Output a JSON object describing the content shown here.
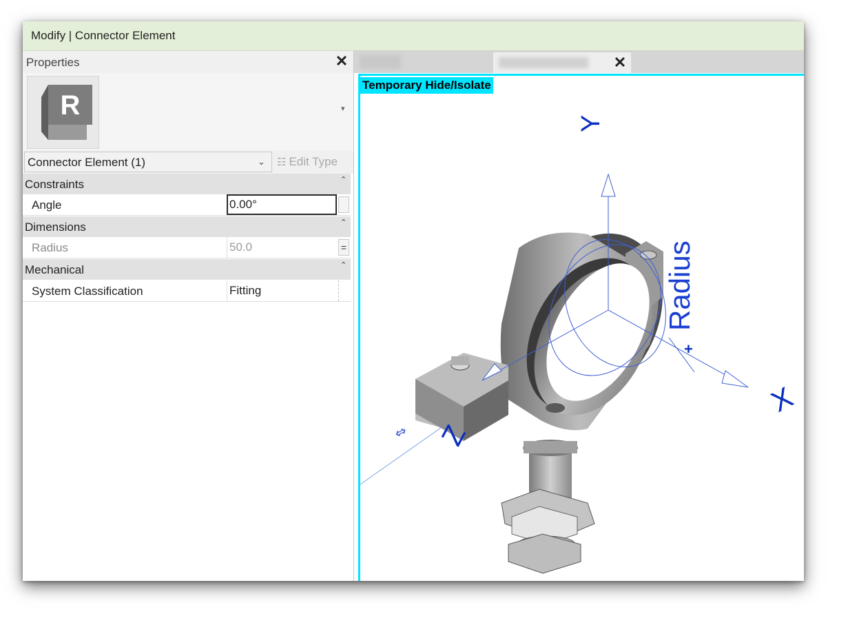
{
  "window": {
    "title": "Modify | Connector Element"
  },
  "properties": {
    "title": "Properties",
    "close_glyph": "✕",
    "type_thumbnail_letter": "R",
    "type_dropdown_glyph": "▾",
    "selector": {
      "value": "Connector Element (1)",
      "chevron": "⌄"
    },
    "edit_type": {
      "icon": "☷",
      "label": "Edit Type"
    },
    "collapse_glyph": "⌃",
    "sections": [
      {
        "label": "Constraints"
      },
      {
        "label": "Dimensions"
      },
      {
        "label": "Mechanical"
      }
    ],
    "rows": {
      "angle": {
        "name": "Angle",
        "value": "0.00°"
      },
      "radius": {
        "name": "Radius",
        "value": "50.0",
        "button": "="
      },
      "system_classification": {
        "name": "System Classification",
        "value": "Fitting"
      }
    }
  },
  "view": {
    "tab_close_glyph": "✕",
    "banner": "Temporary Hide/Isolate",
    "labels": {
      "y": "Y",
      "x": "X",
      "z": "Z",
      "radius": "Radius",
      "plus": "+",
      "flip": "⇔"
    },
    "colors": {
      "accent": "#00e5ff",
      "annotation": "#0b2fbf",
      "title_bar": "#e3efd8"
    }
  }
}
